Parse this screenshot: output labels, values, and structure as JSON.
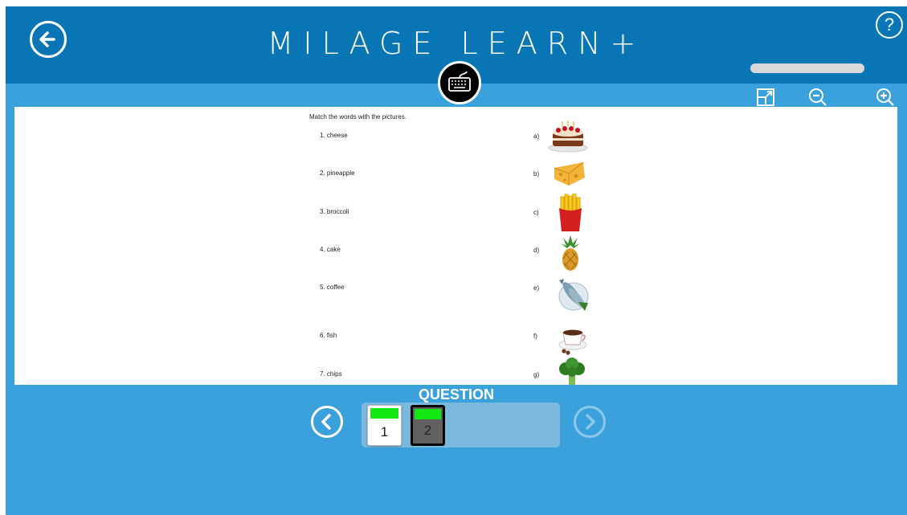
{
  "app": {
    "title": "MILAGE LEARN+"
  },
  "header": {
    "help_label": "?"
  },
  "toolbar": {
    "icons": [
      "fit-screen-icon",
      "zoom-out-icon",
      "zoom-in-icon"
    ]
  },
  "document": {
    "heading": "Match the words with the pictures.",
    "words": [
      "1.  cheese",
      "2.  pineapple",
      "3.  broccoli",
      "4.  cake",
      "5.  coffee",
      "6.  fish",
      "7.  chips"
    ],
    "letters": [
      "a)",
      "b)",
      "c)",
      "d)",
      "e)",
      "f)",
      "g)"
    ],
    "pictures": [
      "cake",
      "cheese",
      "chips",
      "pineapple",
      "fish",
      "coffee",
      "broccoli"
    ]
  },
  "questions": {
    "label": "QUESTION",
    "items": [
      {
        "number": "1",
        "answered": true,
        "current": false
      },
      {
        "number": "2",
        "answered": true,
        "current": true
      }
    ]
  },
  "colors": {
    "header": "#0876b5",
    "background": "#3ba1dc",
    "answered_marker": "#12e812",
    "current_tile": "#616161"
  }
}
